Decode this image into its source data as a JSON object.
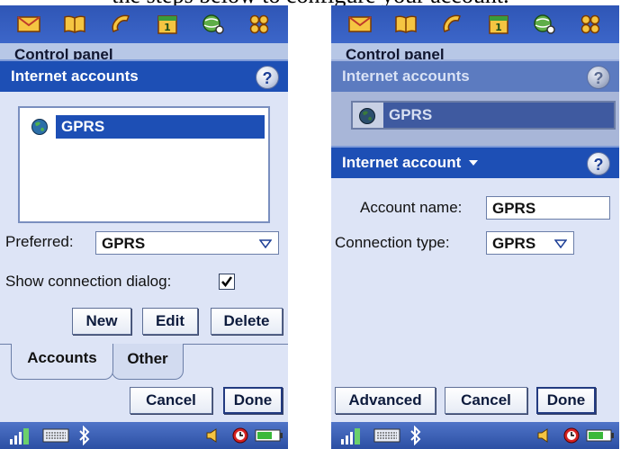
{
  "caption": "the steps below to configure your account.",
  "left": {
    "breadcrumb": "Control panel",
    "title": "Internet accounts",
    "help": "?",
    "accounts_list": [
      {
        "name": "GPRS",
        "selected": true
      }
    ],
    "preferred": {
      "label": "Preferred:",
      "value": "GPRS"
    },
    "show_dialog": {
      "label": "Show connection dialog:",
      "checked": true
    },
    "buttons": {
      "new": "New",
      "edit": "Edit",
      "delete": "Delete"
    },
    "tabs": [
      {
        "label": "Accounts",
        "active": true
      },
      {
        "label": "Other",
        "active": false
      }
    ],
    "footer": {
      "cancel": "Cancel",
      "done": "Done"
    }
  },
  "right": {
    "breadcrumb": "Control panel",
    "background_title": "Internet accounts",
    "help": "?",
    "background_item": "GPRS",
    "dialog_title": "Internet account",
    "account_name": {
      "label": "Account name:",
      "value": "GPRS"
    },
    "connection_type": {
      "label": "Connection type:",
      "value": "GPRS"
    },
    "footer": {
      "advanced": "Advanced",
      "cancel": "Cancel",
      "done": "Done"
    }
  },
  "app_icons": [
    "messaging-icon",
    "contacts-icon",
    "phone-icon",
    "calendar-icon",
    "web-icon",
    "apps-grid-icon"
  ],
  "status_icons": [
    "signal-icon",
    "keyboard-icon",
    "bluetooth-icon",
    "volume-icon",
    "alarm-icon",
    "battery-icon"
  ],
  "colors": {
    "title_bar": "#1d4fb5",
    "background": "#dde4f6",
    "selection": "#1d4fb5",
    "app_bar": "#2f56b6"
  }
}
